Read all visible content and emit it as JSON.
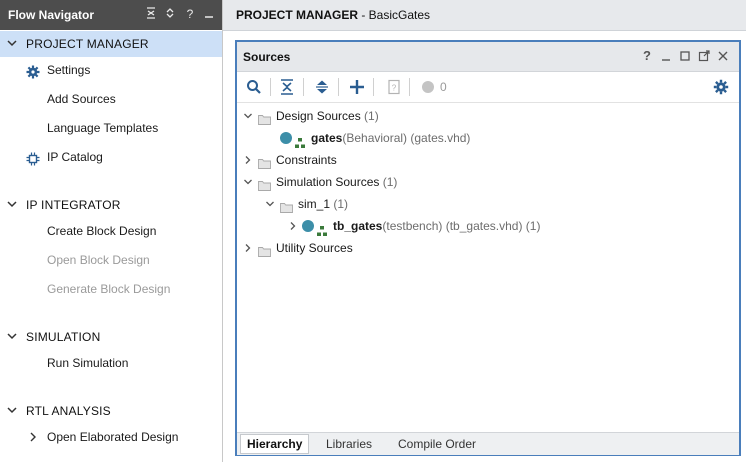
{
  "flow_navigator": {
    "title": "Flow Navigator",
    "header_icons": [
      "collapse-all-icon",
      "expand-all-icon",
      "help-icon",
      "minimize-icon"
    ],
    "help_glyph": "?",
    "sections": [
      {
        "label": "PROJECT MANAGER",
        "expanded": true,
        "selected": true,
        "items": [
          {
            "label": "Settings",
            "icon": "gear-icon",
            "enabled": true
          },
          {
            "label": "Add Sources",
            "enabled": true
          },
          {
            "label": "Language Templates",
            "enabled": true
          },
          {
            "label": "IP Catalog",
            "icon": "ip-chip-icon",
            "enabled": true
          }
        ]
      },
      {
        "label": "IP INTEGRATOR",
        "expanded": true,
        "items": [
          {
            "label": "Create Block Design",
            "enabled": true
          },
          {
            "label": "Open Block Design",
            "enabled": false
          },
          {
            "label": "Generate Block Design",
            "enabled": false
          }
        ]
      },
      {
        "label": "SIMULATION",
        "expanded": true,
        "items": [
          {
            "label": "Run Simulation",
            "enabled": true
          }
        ]
      },
      {
        "label": "RTL ANALYSIS",
        "expanded": true,
        "items": [
          {
            "label": "Open Elaborated Design",
            "enabled": true,
            "collapsed": true
          }
        ]
      }
    ]
  },
  "project_manager": {
    "title": "PROJECT MANAGER",
    "project_name": " - BasicGates"
  },
  "sources_panel": {
    "title": "Sources",
    "header_icons": [
      "help-icon",
      "minimize-icon",
      "maximize-icon",
      "float-icon",
      "close-icon"
    ],
    "help_glyph": "?",
    "toolbar": {
      "buttons": [
        "search-icon",
        "collapse-all-icon",
        "expand-all-icon",
        "add-icon",
        "properties-icon",
        "status-dot-icon",
        "gear-icon"
      ],
      "status_count": "0"
    },
    "tree": [
      {
        "label": "Design Sources",
        "count": " (1)",
        "expanded": true
      },
      {
        "name": "gates",
        "meta": "(Behavioral) (gates.vhd)"
      },
      {
        "label": "Constraints",
        "count": "",
        "expanded": false
      },
      {
        "label": "Simulation Sources",
        "count": " (1)",
        "expanded": true
      },
      {
        "label": "sim_1",
        "count": " (1)",
        "expanded": true
      },
      {
        "name": "tb_gates",
        "meta": "(testbench) (tb_gates.vhd) (1)",
        "expanded": false
      },
      {
        "label": "Utility Sources",
        "count": "",
        "expanded": false
      }
    ],
    "tabs": [
      {
        "label": "Hierarchy",
        "active": true
      },
      {
        "label": "Libraries",
        "active": false
      },
      {
        "label": "Compile Order",
        "active": false
      }
    ]
  },
  "colors": {
    "nav_header": "#4d4d4d",
    "selected_section": "#cde0f7",
    "panel_border": "#4a7ebb",
    "source_dot": "#3c8ea8",
    "accent_icon": "#2a5d91"
  }
}
